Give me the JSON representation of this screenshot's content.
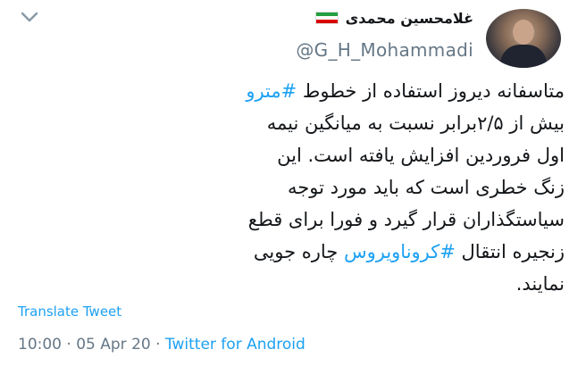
{
  "author": {
    "display_name": "غلامحسین محمدی",
    "handle": "@G_H_Mohammadi"
  },
  "icons": {
    "chevron": "chevron-down-icon",
    "flag": "iran-flag-icon",
    "avatar": "avatar"
  },
  "tweet": {
    "line1_text": "متاسفانه دیروز استفاده از خطوط ",
    "line1_hashtag": "#مترو",
    "line2": "بیش از ۲/۵برابر نسبت به میانگین نیمه",
    "line3": "اول فروردین افزایش یافته است. این",
    "line4": "زنگ خطری است که باید مورد توجه",
    "line5": "سیاستگذاران قرار گیرد و فورا برای قطع",
    "line6_text_before": "زنجیره انتقال ",
    "line6_hashtag": "#کروناویروس",
    "line6_text_after": " چاره جویی",
    "line7": "نمایند."
  },
  "translate_label": "Translate Tweet",
  "meta": {
    "time": "10:00",
    "separator1": " · ",
    "date": "05 Apr 20",
    "separator2": " · ",
    "source": "Twitter for Android"
  },
  "colors": {
    "link": "#1da1f2",
    "text": "#14171a",
    "secondary": "#657786"
  }
}
